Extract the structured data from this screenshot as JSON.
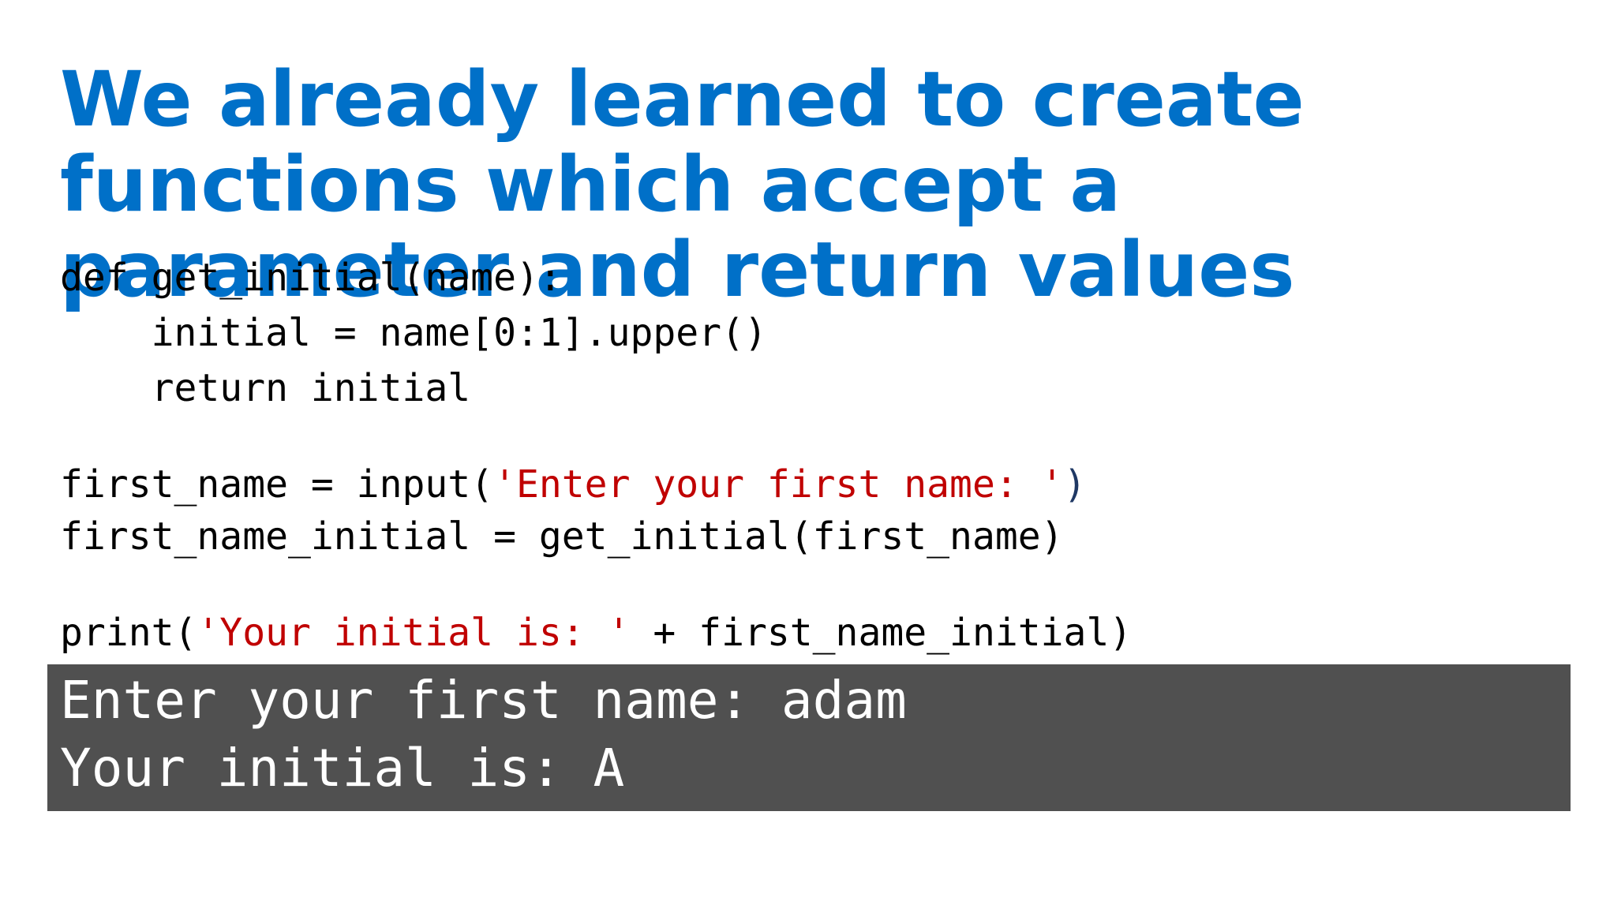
{
  "title": {
    "lines": [
      "We already learned to create",
      "functions which accept a",
      "parameter and return values"
    ]
  },
  "code": {
    "line1": "def get_initial(name):",
    "line2": "    initial = name[0:1].upper()",
    "line3": "    return initial",
    "line4_pre": "first_name = input(",
    "line4_str": "'Enter your first name: '",
    "line4_post": ")",
    "line5": "first_name_initial = get_initial(first_name)",
    "line6_pre": "print(",
    "line6_str": "'Your initial is: '",
    "line6_post": " + first_name_initial)"
  },
  "output": {
    "line1": "Enter your first name: adam",
    "line2": "Your initial is: A"
  },
  "colors": {
    "title": "#0070C8",
    "string": "#C00000",
    "output_bg": "#505050",
    "output_text": "#ffffff"
  }
}
